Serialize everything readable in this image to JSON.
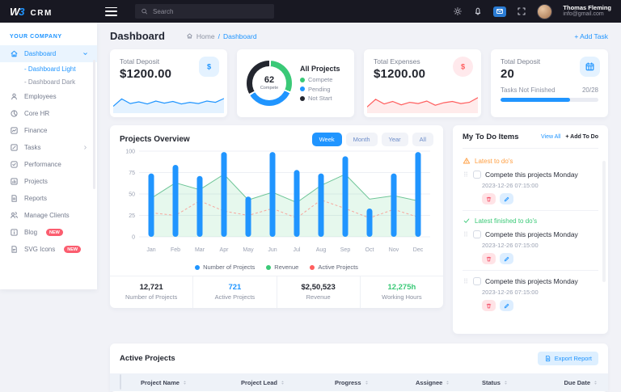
{
  "brand": {
    "logo_w": "W",
    "logo_3": "3",
    "logo_text": "CRM"
  },
  "topbar": {
    "search_placeholder": "Search",
    "user": {
      "name": "Thomas Fleming",
      "email": "info@gmail.com"
    }
  },
  "page_header": {
    "title": "Dashboard",
    "breadcrumb_home": "Home",
    "breadcrumb_sep": "/",
    "breadcrumb_current": "Dashboard",
    "add_task": "+ Add Task"
  },
  "sidebar": {
    "section_label": "YOUR COMPANY",
    "sub_prefix": "- ",
    "items": [
      {
        "icon": "home",
        "label": "Dashboard",
        "active": true,
        "chevron": "down",
        "children": [
          {
            "label": "Dashboard Light",
            "active": true
          },
          {
            "label": "Dashboard Dark",
            "active": false
          }
        ]
      },
      {
        "icon": "user",
        "label": "Employees"
      },
      {
        "icon": "pie",
        "label": "Core HR"
      },
      {
        "icon": "finance",
        "label": "Finance"
      },
      {
        "icon": "tasks",
        "label": "Tasks",
        "chevron": "right"
      },
      {
        "icon": "performance",
        "label": "Performance"
      },
      {
        "icon": "projects",
        "label": "Projects"
      },
      {
        "icon": "reports",
        "label": "Reports"
      },
      {
        "icon": "clients",
        "label": "Manage Clients"
      },
      {
        "icon": "blog",
        "label": "Blog",
        "badge": "NEW"
      },
      {
        "icon": "svgfile",
        "label": "SVG Icons",
        "badge": "NEW"
      }
    ]
  },
  "stat_cards": [
    {
      "title": "Total Deposit",
      "value": "$1200.00",
      "icon": "dollar",
      "accent": "#2095FF"
    },
    {
      "title": "All Projects",
      "center_value": "62",
      "center_label": "Compete"
    },
    {
      "title": "Total Expenses",
      "value": "$1200.00",
      "icon": "dollar",
      "accent": "#FF5E5E"
    },
    {
      "title": "Total Deposit",
      "value": "20",
      "icon": "calendar",
      "accent": "#2095FF",
      "sub_label": "Tasks Not Finished",
      "sub_value": "20/28",
      "progress_pct": 71
    }
  ],
  "projects_overview": {
    "title": "Projects Overview",
    "tabs": [
      "Week",
      "Month",
      "Year",
      "All"
    ],
    "active_tab": "Week"
  },
  "overview_stats": [
    {
      "value": "12,721",
      "label": "Number of Projects",
      "color": "#23262f"
    },
    {
      "value": "721",
      "label": "Active Projects",
      "color": "#2095ff"
    },
    {
      "value": "$2,50,523",
      "label": "Revenue",
      "color": "#23262f"
    },
    {
      "value": "12,275h",
      "label": "Working Hours",
      "color": "#3ac977"
    }
  ],
  "todo": {
    "title": "My To Do Items",
    "view_all": "View All",
    "add_label": "+ Add To Do",
    "items": [
      {
        "section_type": "warning",
        "section_label": "Latest to do's",
        "text": "Compete this projects Monday",
        "time": "2023-12-26 07:15:00"
      },
      {
        "section_type": "success",
        "section_label": "Latest finished to do's",
        "text": "Compete this projects Monday",
        "time": "2023-12-26 07:15:00"
      },
      {
        "section_type": null,
        "section_label": null,
        "text": "Compete this projects Monday",
        "time": "2023-12-26 07:15:00"
      }
    ]
  },
  "active_projects": {
    "title": "Active Projects",
    "export_label": "Export Report",
    "columns": [
      "Project Name",
      "Project Lead",
      "Progress",
      "Assignee",
      "Status",
      "Due Date"
    ]
  },
  "chart_data": [
    {
      "type": "pie",
      "subtype": "donut",
      "title": "All Projects",
      "center_value": "62",
      "center_label": "Compete",
      "slices": [
        {
          "label": "Compete",
          "value": 31,
          "color": "#3AC977"
        },
        {
          "label": "Pending",
          "value": 35,
          "color": "#2095FF"
        },
        {
          "label": "Not Start",
          "value": 34,
          "color": "#23262F"
        }
      ]
    },
    {
      "type": "bar",
      "title": "Projects Overview",
      "categories": [
        "Jan",
        "Feb",
        "Mar",
        "Apr",
        "May",
        "Jun",
        "Jul",
        "Aug",
        "Sep",
        "Oct",
        "Nov",
        "Dec"
      ],
      "series": [
        {
          "name": "Number of Projects",
          "type": "bar",
          "color": "#2095FF",
          "values": [
            74,
            84,
            71,
            99,
            47,
            99,
            78,
            74,
            94,
            33,
            74,
            99
          ]
        },
        {
          "name": "Revenue",
          "type": "area",
          "color": "#3AC977",
          "values": [
            45,
            63,
            55,
            73,
            43,
            52,
            40,
            60,
            73,
            44,
            48,
            42
          ]
        },
        {
          "name": "Active Projects",
          "type": "dashed-line",
          "color": "#FF5E5E",
          "values": [
            28,
            25,
            42,
            30,
            25,
            33,
            22,
            43,
            33,
            22,
            32,
            23
          ]
        }
      ],
      "ylim": [
        0,
        100
      ],
      "yticks": [
        0,
        25,
        50,
        75,
        100
      ],
      "grid": true,
      "legend_position": "bottom"
    },
    {
      "type": "line",
      "title": "Total Deposit sparkline",
      "color": "#2095FF",
      "values": [
        25,
        60,
        38,
        46,
        36,
        50,
        40,
        48,
        36,
        44,
        38,
        50,
        44,
        62
      ]
    },
    {
      "type": "line",
      "title": "Total Expenses sparkline",
      "color": "#FF5E5E",
      "values": [
        22,
        58,
        36,
        48,
        32,
        44,
        38,
        50,
        30,
        42,
        48,
        38,
        44,
        66
      ]
    }
  ]
}
